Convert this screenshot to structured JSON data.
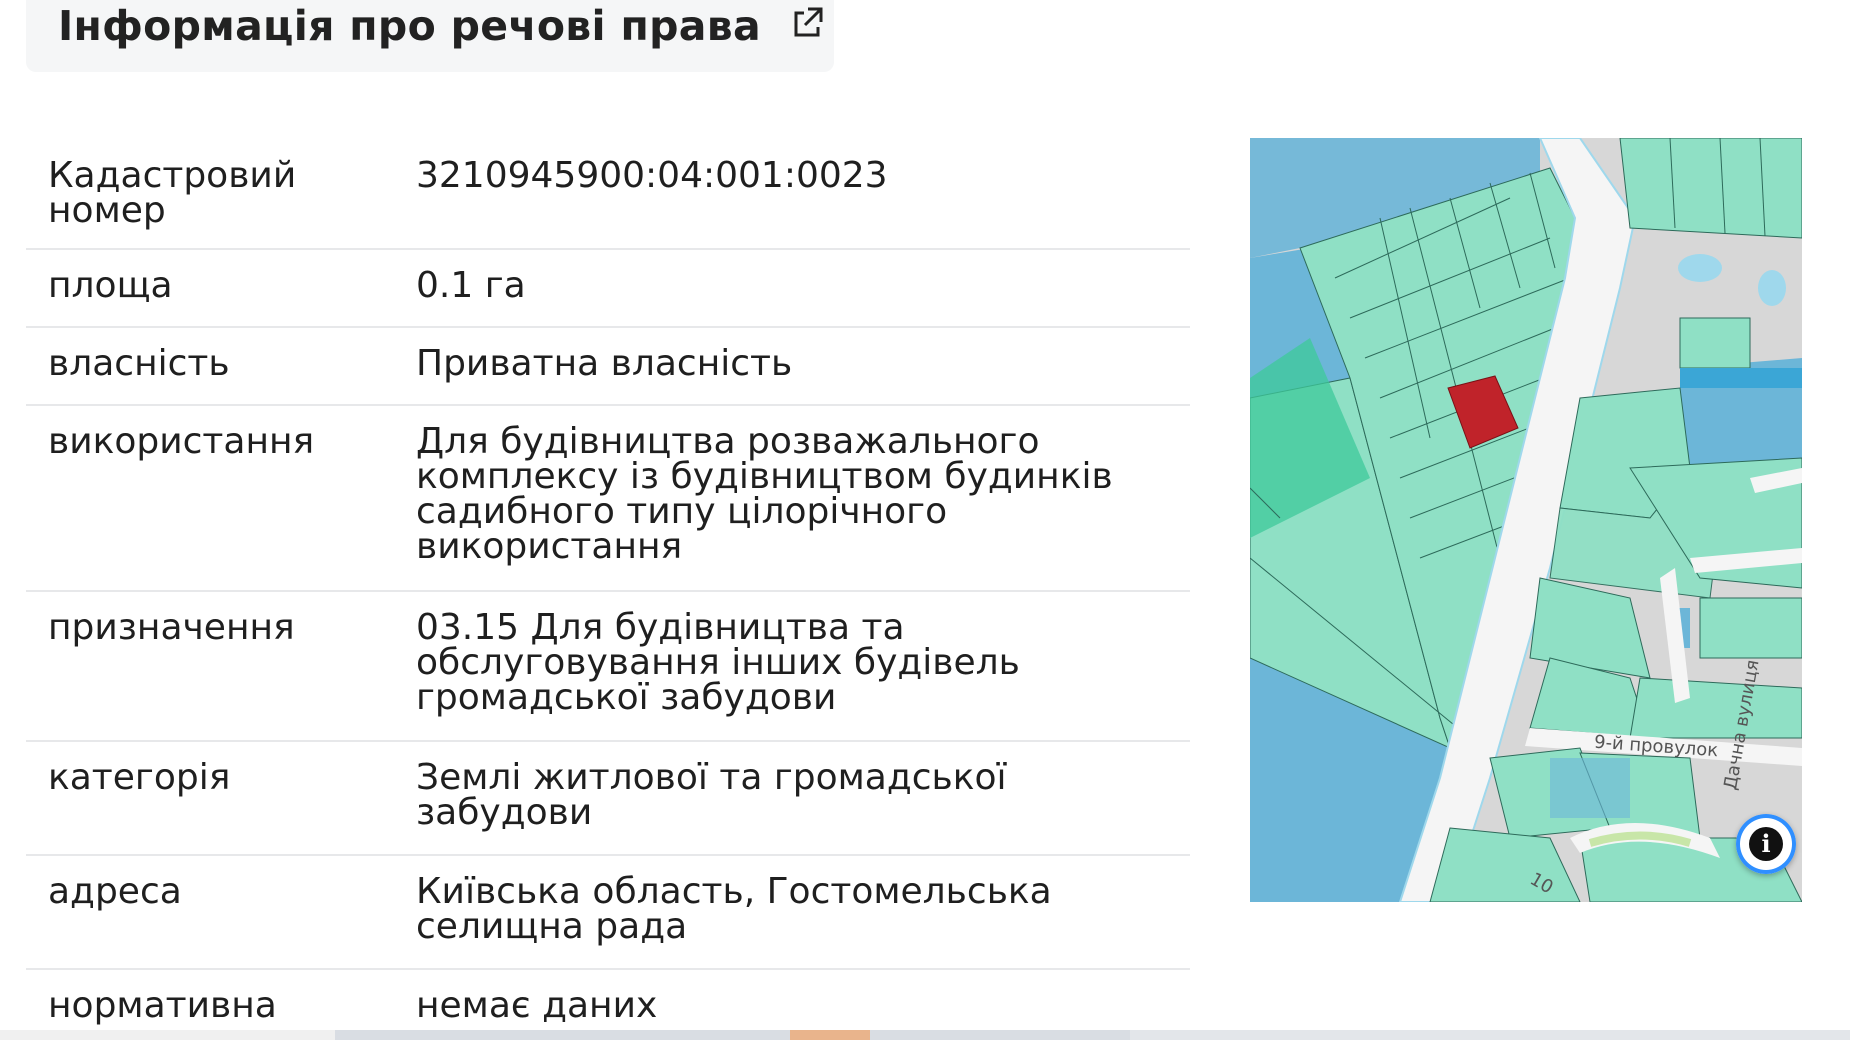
{
  "header": {
    "title": "Інформація про речові права",
    "link_icon": "external-link-icon"
  },
  "rows": [
    {
      "label": "Кадастровий номер",
      "value": "3210945900:04:001:0023"
    },
    {
      "label": "площа",
      "value": "0.1 га"
    },
    {
      "label": "власність",
      "value": "Приватна власність"
    },
    {
      "label": "використання",
      "value": "Для будівництва розважального комплексу із будівництвом будинків садибного типу цілорічного використання"
    },
    {
      "label": "призначення",
      "value": "03.15 Для будівництва та обслуговування інших будівель громадської забудови"
    },
    {
      "label": "категорія",
      "value": "Землі житлової та громадської забудови"
    },
    {
      "label": "адреса",
      "value": "Київська область, Гостомельська селищна рада"
    },
    {
      "label": "нормативна",
      "value": "немає даних"
    }
  ],
  "map": {
    "street_labels": [
      "9-й провулок",
      "Дачна вулиця",
      "10"
    ],
    "info_icon": "info-icon",
    "colors": {
      "parcel": "#8fe0c5",
      "parcel_dark": "#3ec99a",
      "water": "#6cb6d8",
      "road": "#f5f5f5",
      "selected": "#c0232a"
    }
  }
}
